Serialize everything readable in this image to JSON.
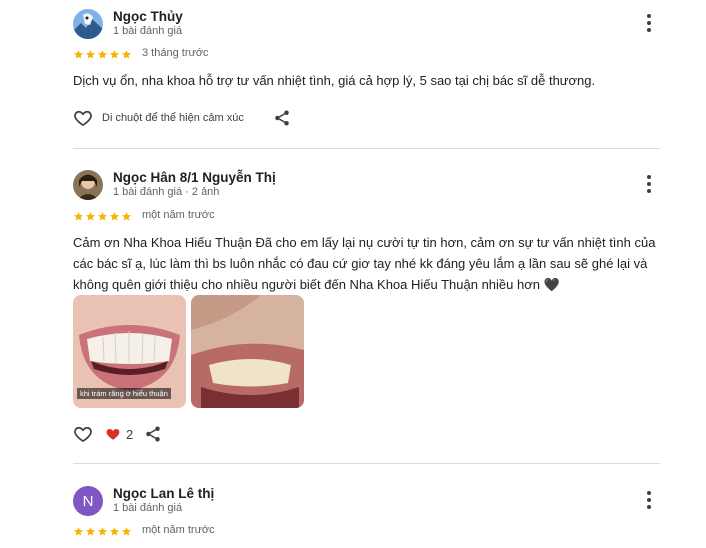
{
  "reviews": [
    {
      "name": "Ngọc Thủy",
      "meta": "1 bài đánh giá",
      "date": "3 tháng trước",
      "text": "Dịch vụ ổn, nha khoa hỗ trợ tư vấn nhiệt tình, giá cả hợp lý, 5 sao tại chị bác sĩ dễ thương.",
      "hover_text": "Di chuột để thể hiện cảm xúc",
      "rating": 5
    },
    {
      "name": "Ngọc Hân 8/1 Nguyễn Thị",
      "meta": "1 bài đánh giá · 2 ảnh",
      "date": "một năm trước",
      "text": "Cảm ơn Nha Khoa Hiếu Thuận Đã cho em lấy lại nụ cười tự tin hơn, cảm ơn sự tư vấn nhiệt tình của các bác sĩ ạ, lúc làm thì bs luôn nhắc có đau cứ giơ tay nhé kk đáng yêu lắm ạ lần sau sẽ ghé lại và không quên giới thiệu cho nhiều người biết đến Nha Khoa Hiếu Thuận nhiều hơn 🖤",
      "photo_caption": "khi trám răng ở hiếu thuận",
      "like_count": "2",
      "rating": 5
    },
    {
      "name": "Ngọc Lan Lê thị",
      "meta": "1 bài đánh giá",
      "date": "một năm trước",
      "avatar_letter": "N",
      "rating": 5
    }
  ],
  "colors": {
    "star": "#f4b400",
    "heart_filled": "#d93025",
    "avatar_purple": "#7e57c2",
    "divider": "#dadce0"
  },
  "icons": [
    "more-vert-icon",
    "star-icon",
    "heart-outline-icon",
    "heart-filled-icon",
    "share-icon"
  ]
}
